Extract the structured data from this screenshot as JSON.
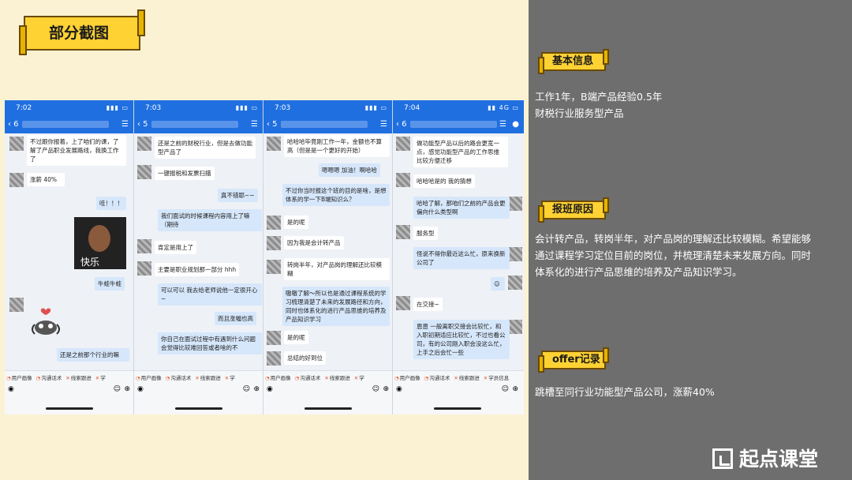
{
  "title": "部分截图",
  "sections": [
    {
      "tag": "基本信息",
      "lines": [
        "工作1年，B端产品经验0.5年",
        "财税行业服务型产品"
      ]
    },
    {
      "tag": "报班原因",
      "lines": [
        "会计转产品，转岗半年，对产品岗的理解还比较模糊。希望能够",
        "通过课程学习定位目前的岗位，并梳理清楚未来发展方向。同时",
        "体系化的进行产品思维的培养及产品知识学习。"
      ]
    },
    {
      "tag": "offer记录",
      "lines": [
        "跳槽至同行业功能型产品公司，涨薪40%"
      ]
    }
  ],
  "logo": "起点课堂",
  "phones": [
    {
      "time": "7:02",
      "messages": [
        {
          "side": "in",
          "text": "不过跟你报着，上了咱们的课，了解了产品职业发展路线，我换工作了"
        },
        {
          "side": "in",
          "text": "涨薪 40%"
        },
        {
          "side": "out",
          "text": "哇！！！"
        },
        {
          "side": "out",
          "text": "牛蛙牛蛙"
        },
        {
          "side": "in",
          "text": "还是之前那个行业的嘛"
        }
      ],
      "image_caption": "快乐"
    },
    {
      "time": "7:03",
      "messages": [
        {
          "side": "in",
          "text": "还是之前的财税行业，但是去做功能型产品了"
        },
        {
          "side": "in",
          "text": "一键报税和发票扫描"
        },
        {
          "side": "out",
          "text": "真不错耶~~"
        },
        {
          "side": "out",
          "text": "我们面试的时候课程内容用上了嘛（期待"
        },
        {
          "side": "in",
          "text": "肯定是用上了"
        },
        {
          "side": "in",
          "text": "主要是职业规划那一部分 hhh"
        },
        {
          "side": "out",
          "text": "可以可以 我去给老师说他一定很开心~"
        },
        {
          "side": "out",
          "text": "而且涨幅也高"
        },
        {
          "side": "out",
          "text": "你自己在面试过程中有遇到什么问题会觉得比较难回答或者啥的不"
        }
      ]
    },
    {
      "time": "7:03",
      "messages": [
        {
          "side": "in",
          "text": "哈哈哈毕竟刚工作一年，金额也不算高（但是是一个更好的开始）"
        },
        {
          "side": "out",
          "text": "嗯嗯嗯 加油！啊哈哈"
        },
        {
          "side": "out",
          "text": "不过你当时报这个班的目的是啥，是想体系的学一下B端知识么？"
        },
        {
          "side": "in",
          "text": "是的呢"
        },
        {
          "side": "in",
          "text": "因为我是会计转产品"
        },
        {
          "side": "in",
          "text": "转岗半年，对产品岗的理解还比较模糊"
        },
        {
          "side": "out",
          "text": "嗷嗷了解～所以也是通过课程系统的学习梳理清楚了未来的发展路径和方向，同时也体系化的进行产品思维的培养及产品知识学习"
        },
        {
          "side": "in",
          "text": "是的呢"
        },
        {
          "side": "in",
          "text": "总结的好到位"
        }
      ]
    },
    {
      "time": "7:04",
      "messages": [
        {
          "side": "in",
          "text": "做功能型产品以后的路会更宽一点，感觉功能型产品的工作思维比较方便迁移"
        },
        {
          "side": "in",
          "text": "哈哈哈是的 我的猜想"
        },
        {
          "side": "out",
          "text": "哈哈了解，那咱们之前的产品会更偏向什么类型啊"
        },
        {
          "side": "in",
          "text": "服务型"
        },
        {
          "side": "out",
          "text": "怪说不得你最近这么忙，原来换新公司了"
        },
        {
          "side": "in",
          "text": "在交接~"
        },
        {
          "side": "out",
          "text": "恩恩 一般离职交接会比较忙，和入职初期适应比较忙，不过也看公司，有的公司刚入职会没这么忙，上手之后会忙一些"
        }
      ]
    }
  ],
  "quick_buttons": [
    "用户画像",
    "沟通话术",
    "线索跟进",
    "学"
  ],
  "quick_buttons_last": [
    "用户画像",
    "沟通话术",
    "线索跟进",
    "学员信息"
  ]
}
